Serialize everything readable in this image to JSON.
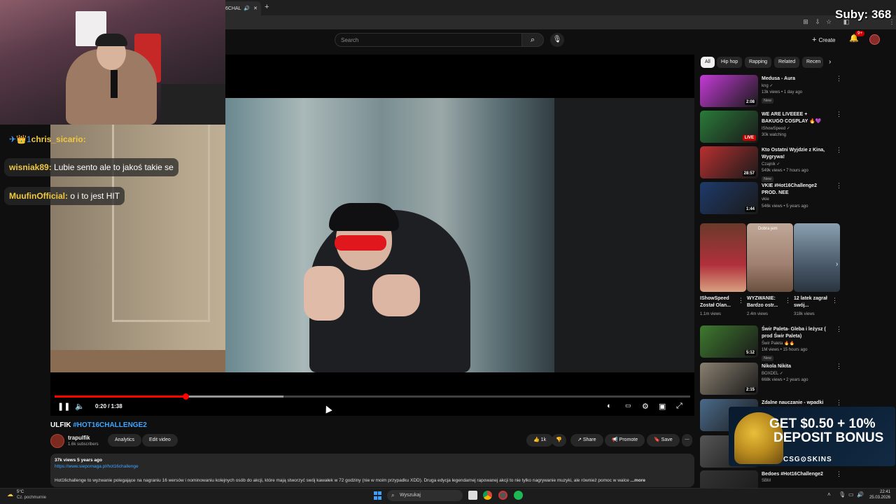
{
  "browser": {
    "tab_title": "6CHAL",
    "new_tab": "+",
    "tab_close": "✕"
  },
  "stream_overlay": {
    "subs_counter": "Suby: 368",
    "chat": [
      {
        "name": "chris_sicario:",
        "message": "",
        "badges": "✈👑1"
      },
      {
        "name": "wisniak89:",
        "message": " Lubie sento ale to jakoś takie se"
      },
      {
        "name": "MuufinOfficial:",
        "message": " o i to jest HIT"
      }
    ]
  },
  "youtube_header": {
    "search_placeholder": "Search",
    "create_label": "Create",
    "notif_badge": "9+"
  },
  "player": {
    "time": "0:20 / 1:38",
    "progress_fraction": 0.206,
    "buffered_fraction": 0.36
  },
  "video": {
    "title_prefix": "ULFIK ",
    "title_tag": "#HOT16CHALLENGE2",
    "channel": "trapulfik",
    "subscribers": "1.6k subscribers",
    "analytics": "Analytics",
    "edit_video": "Edit video",
    "likes": "1k",
    "share": "Share",
    "promote": "Promote",
    "save": "Save",
    "stats": "37k views  5 years ago",
    "link": "https://www.siepomaga.pl/hot16challenge",
    "description": "Hot16challenge to wyzwanie polegające na nagraniu 16 wersów i nominowaniu kolejnych osób do akcji, które mają stworzyć swój kawałek w 72 godziny (nie w moim przypadku XDD). Druga edycja legendarnej rapowanej akcji to nie tylko nagrywanie muzyki, ale również pomoc w walce",
    "more": "...more"
  },
  "sidebar": {
    "chips": [
      "All",
      "Hip hop",
      "Rapping",
      "Related",
      "Recen"
    ],
    "videos": [
      {
        "title": "Medusa - Aura",
        "channel": "kng ✓",
        "meta": "13k views • 1 day ago",
        "badge": "New",
        "duration": "2:08",
        "color": "#c43ad6"
      },
      {
        "title": "WE ARE LIVEEEE + BAKUGO COSPLAY 🔥💜",
        "channel": "IShowSpeed ✓",
        "meta": "30k watching",
        "badge": "",
        "duration": "LIVE",
        "color": "#2a7a3a"
      },
      {
        "title": "Kto Ostatni Wyjdzie z Kina, Wygrywa!",
        "channel": "Czajnik ✓",
        "meta": "549k views • 7 hours ago",
        "badge": "New",
        "duration": "28:57",
        "color": "#b83030"
      },
      {
        "title": "VKIE #Hot16Challenge2 PROD. NEE",
        "channel": "vkie",
        "meta": "546k views • 5 years ago",
        "badge": "",
        "duration": "1:44",
        "color": "#1e3a6a"
      },
      {
        "title": "Świr Paleta- Gleba i leżysz ( prod Świr Paleta)",
        "channel": "Świr Paleta 🔥🔥",
        "meta": "1M views • 15 hours ago",
        "badge": "New",
        "duration": "5:12",
        "color": "#3e7a2e"
      },
      {
        "title": "Nikola Nikita",
        "channel": "BOXDEL ✓",
        "meta": "668k views • 2 years ago",
        "badge": "",
        "duration": "2:15",
        "color": "#8a8070"
      },
      {
        "title": "Zdalne nauczanie - wpadki #1",
        "channel": "",
        "meta": "",
        "badge": "",
        "duration": "",
        "color": "#4a6a8a"
      },
      {
        "title": "",
        "channel": "",
        "meta": "",
        "badge": "",
        "duration": "",
        "color": "#555"
      },
      {
        "title": "Bedoes #Hot16Challenge2",
        "channel": "SBM",
        "meta": "",
        "badge": "",
        "duration": "",
        "color": "#333"
      }
    ],
    "shorts": [
      {
        "title": "IShowSpeed Został Olan...",
        "views": "1.1m views",
        "color": "#b0303a"
      },
      {
        "title": "WYZWANIE: Bardzo ostr...",
        "views": "2.4m views",
        "color": "#a08070",
        "overlay": "Dobra jem"
      },
      {
        "title": "12 latek zagrał swój...",
        "views": "318k views",
        "color": "#4a5a6a"
      }
    ]
  },
  "ad": {
    "line1": "GET $0.50 + 10%",
    "line2": "DEPOSIT BONUS",
    "brand": "CSG⊙SKINS"
  },
  "taskbar": {
    "temp": "5°C",
    "weather": "Cz. pochmurnie",
    "search": "Wyszukaj",
    "time": "22:41",
    "date": "25.03.2026"
  }
}
